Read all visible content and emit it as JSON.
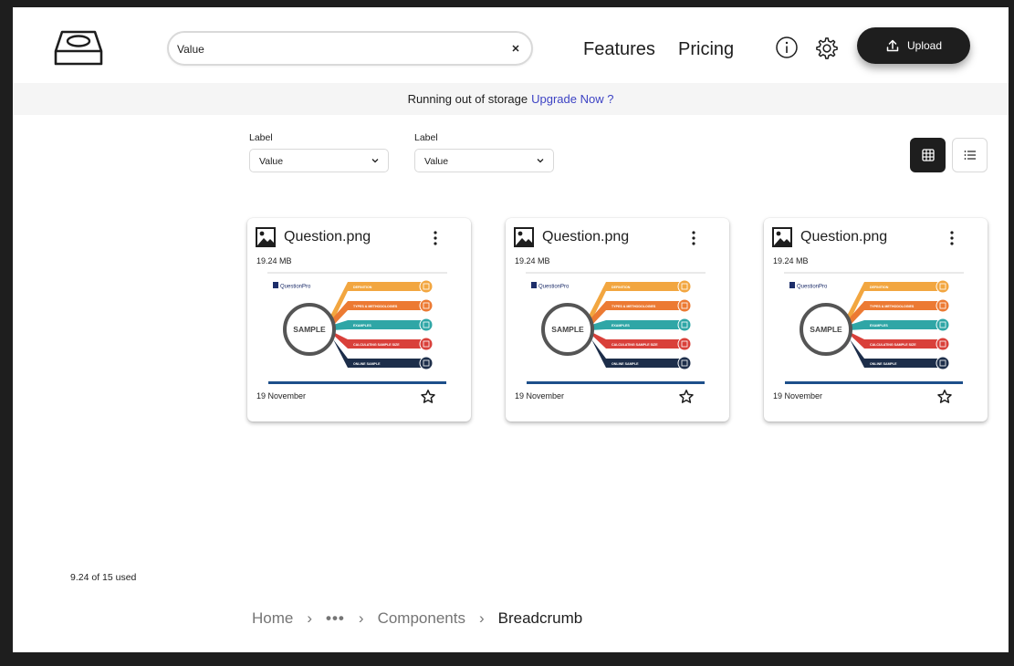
{
  "header": {
    "logo_icon": "hard-drive-icon",
    "search": {
      "value": "Value",
      "clear_icon": "close-icon"
    },
    "nav": [
      {
        "label": "Features"
      },
      {
        "label": "Pricing"
      }
    ],
    "info_icon": "info-icon",
    "settings_icon": "gear-icon",
    "upload": {
      "label": "Upload",
      "icon": "upload-icon"
    }
  },
  "banner": {
    "text": "Running out of storage",
    "link": "Upgrade Now ?"
  },
  "filters": [
    {
      "label": "Label",
      "value": "Value"
    },
    {
      "label": "Label",
      "value": "Value"
    }
  ],
  "view_toggle": {
    "active": "grid",
    "grid_icon": "grid-icon",
    "list_icon": "list-icon"
  },
  "files": [
    {
      "name": "Question.png",
      "size": "19.24 MB",
      "date": "19 November",
      "starred": false
    },
    {
      "name": "Question.png",
      "size": "19.24 MB",
      "date": "19 November",
      "starred": false
    },
    {
      "name": "Question.png",
      "size": "19.24 MB",
      "date": "19 November",
      "starred": false
    }
  ],
  "thumbnail": {
    "brand": "QuestionPro",
    "center": "SAMPLE",
    "items": [
      {
        "label": "DEFINITION",
        "color": "#f2a640"
      },
      {
        "label": "TYPES & METHODOLOGIES",
        "color": "#ec7a33"
      },
      {
        "label": "EXAMPLES",
        "color": "#2fa6a6"
      },
      {
        "label": "CALCULATING SAMPLE SIZE",
        "color": "#d9403a"
      },
      {
        "label": "ONLINE SAMPLE",
        "color": "#1d2e4a"
      }
    ]
  },
  "storage": {
    "text": "9.24 of 15 used"
  },
  "breadcrumb": {
    "items": [
      "Home",
      "Components"
    ],
    "ellipsis": "•••",
    "current": "Breadcrumb"
  },
  "colors": {
    "primary": "#1e1e1e",
    "link": "#3d43c4",
    "banner_bg": "#f5f5f5",
    "muted": "#757575"
  }
}
